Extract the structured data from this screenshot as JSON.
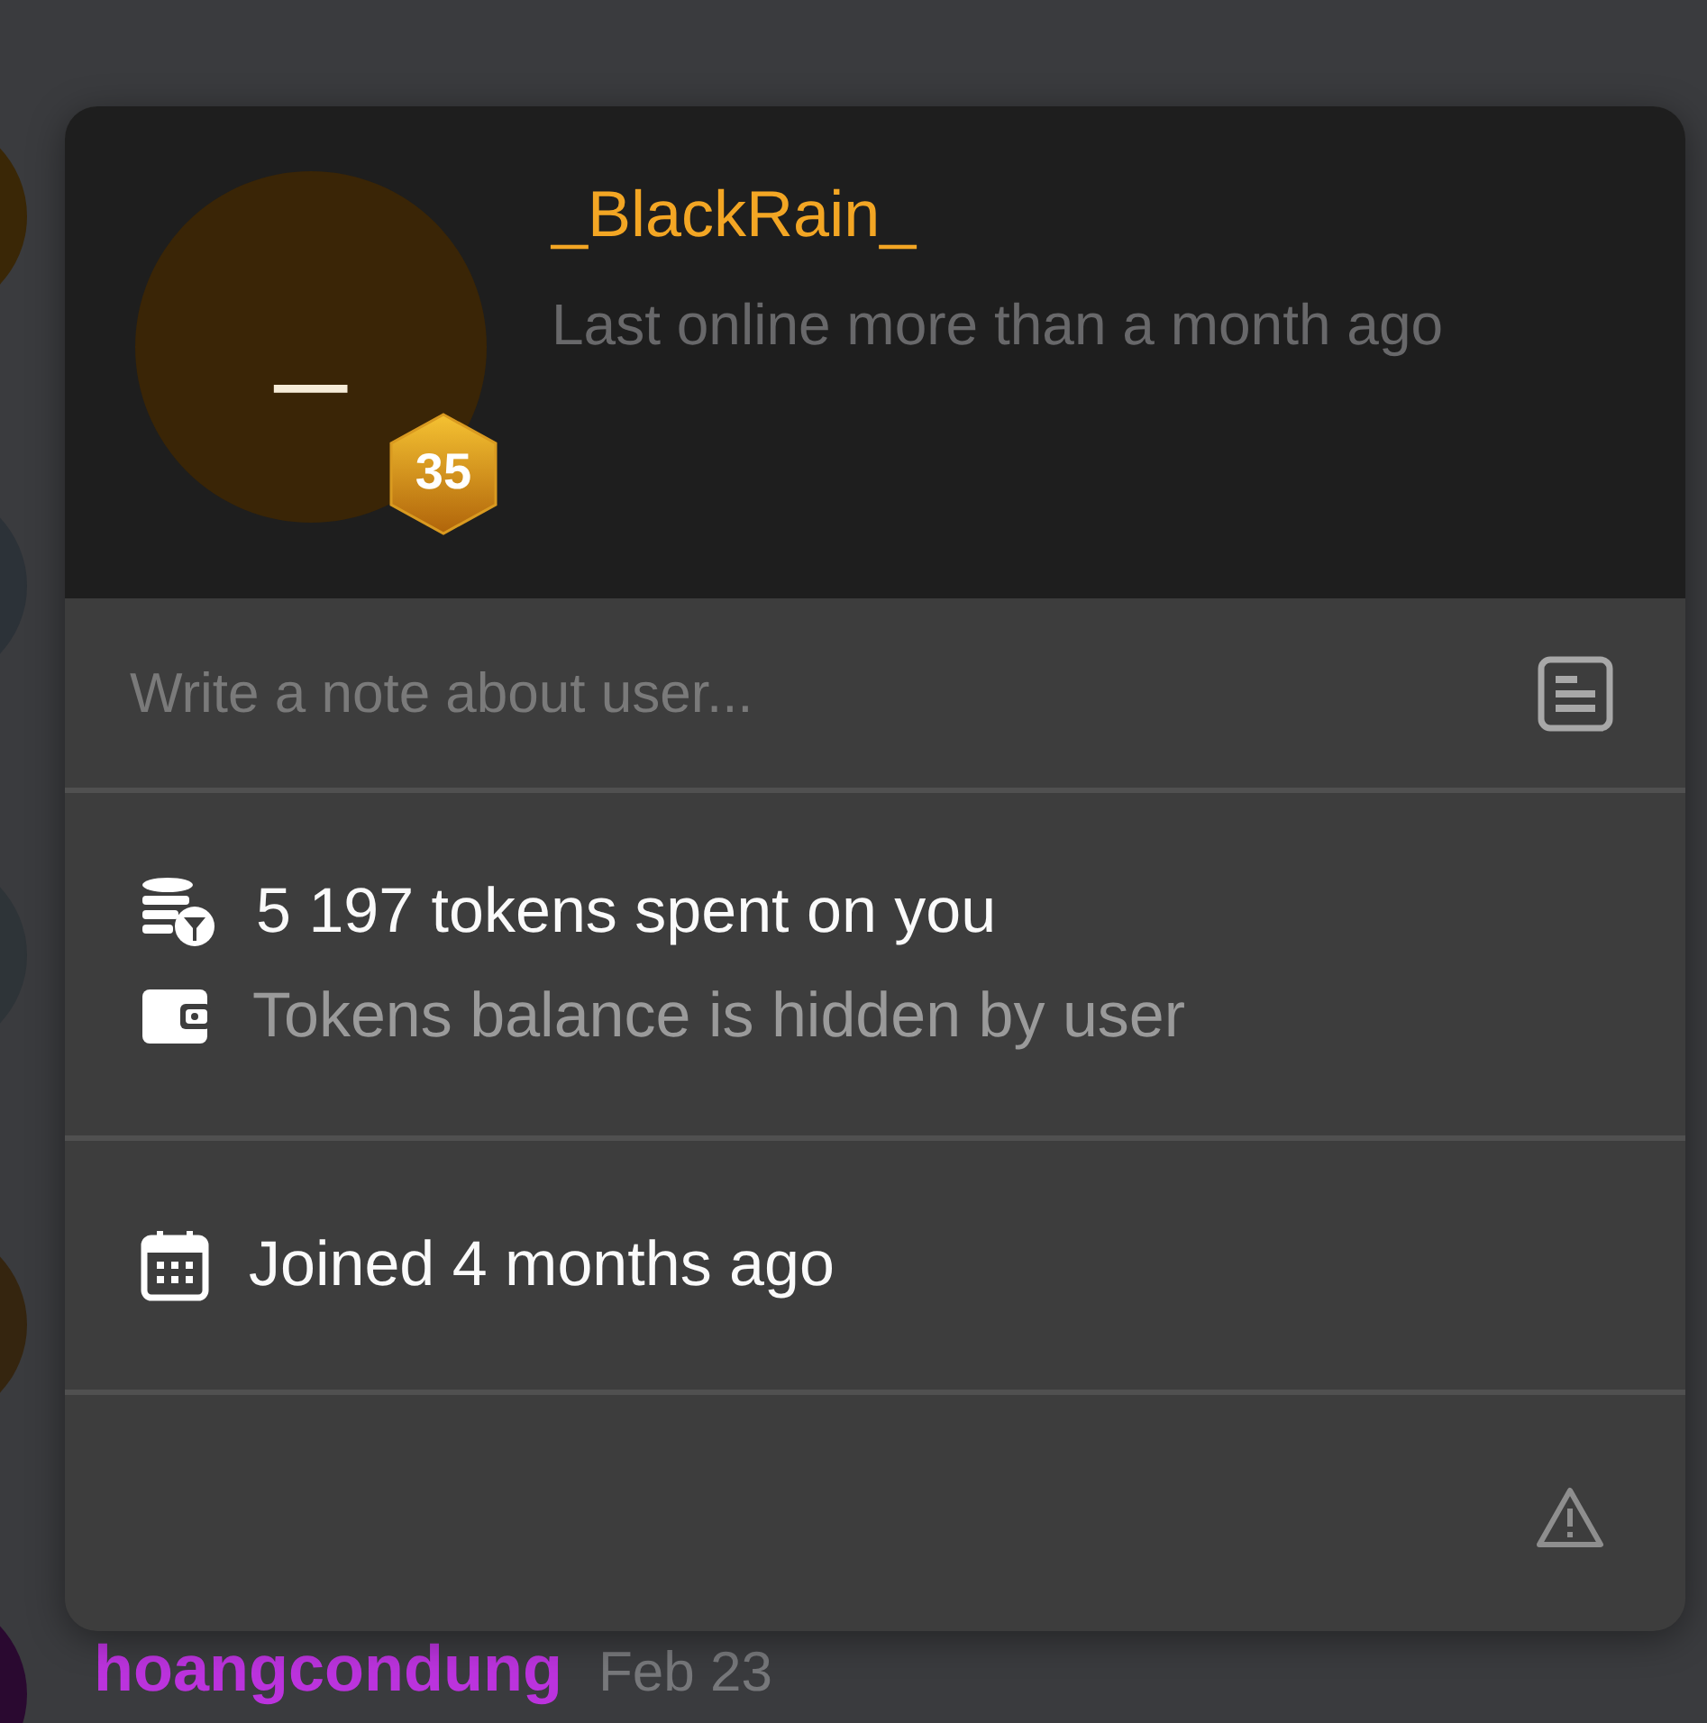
{
  "chat_rows": [
    {
      "color": "#3a2706"
    },
    {
      "color": "#2c3238"
    },
    {
      "color": "#2e3438"
    },
    {
      "color": "#35250f"
    },
    {
      "color": "#2a0930",
      "author": "hoangcondung",
      "date": "Feb 23"
    }
  ],
  "profile_card": {
    "avatar_initial": "_",
    "level_badge": "35",
    "username": "_BlackRain_",
    "last_online": "Last online more than a month ago",
    "note": {
      "placeholder": "Write a note about user..."
    },
    "tokens_spent": "5 197 tokens spent on you",
    "tokens_balance": "Tokens balance is hidden by user",
    "joined": "Joined 4 months ago"
  }
}
